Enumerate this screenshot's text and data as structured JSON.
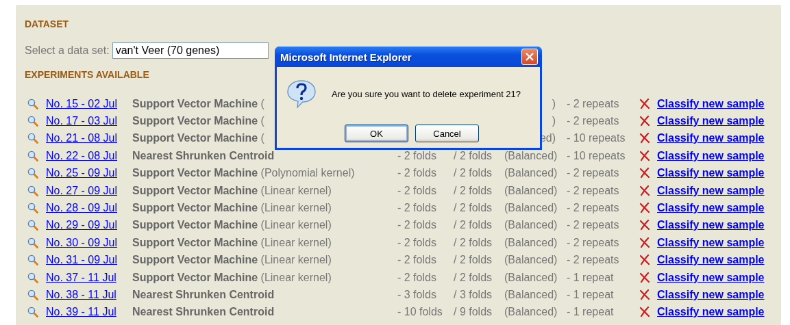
{
  "dataset": {
    "heading": "DATASET",
    "select_label": "Select a data set:",
    "select_value": "van't Veer (70 genes)"
  },
  "experiments": {
    "heading": "EXPERIMENTS AVAILABLE",
    "rows": [
      {
        "date": "No. 15 - 02 Jul",
        "method": "Support Vector Machine",
        "kernel": "(",
        "balance": ")",
        "repeats": "- 2 repeats",
        "action": "Classify new sample"
      },
      {
        "date": "No. 17 - 03 Jul",
        "method": "Support Vector Machine",
        "kernel": "(",
        "balance": ")",
        "repeats": "- 2 repeats",
        "action": "Classify new sample"
      },
      {
        "date": "No. 21 - 08 Jul",
        "method": "Support Vector Machine",
        "kernel": "(",
        "balance": "ed)",
        "repeats": "- 10 repeats",
        "action": "Classify new sample"
      },
      {
        "date": "No. 22 - 08 Jul",
        "method": "Nearest Shrunken Centroid",
        "folds": "- 2 folds",
        "inner_folds": "/ 2 folds",
        "balance": "(Balanced)",
        "repeats": "- 10 repeats",
        "action": "Classify new sample"
      },
      {
        "date": "No. 25 - 09 Jul",
        "method": "Support Vector Machine",
        "kernel": "(Polynomial kernel)",
        "folds": "- 2 folds",
        "inner_folds": "/ 2 folds",
        "balance": "(Balanced)",
        "repeats": "- 2 repeats",
        "action": "Classify new sample"
      },
      {
        "date": "No. 27 - 09 Jul",
        "method": "Support Vector Machine",
        "kernel": "(Linear kernel)",
        "folds": "- 2 folds",
        "inner_folds": "/ 2 folds",
        "balance": "(Balanced)",
        "repeats": "- 2 repeats",
        "action": "Classify new sample"
      },
      {
        "date": "No. 28 - 09 Jul",
        "method": "Support Vector Machine",
        "kernel": "(Linear kernel)",
        "folds": "- 2 folds",
        "inner_folds": "/ 2 folds",
        "balance": "(Balanced)",
        "repeats": "- 2 repeats",
        "action": "Classify new sample"
      },
      {
        "date": "No. 29 - 09 Jul",
        "method": "Support Vector Machine",
        "kernel": "(Linear kernel)",
        "folds": "- 2 folds",
        "inner_folds": "/ 2 folds",
        "balance": "(Balanced)",
        "repeats": "- 2 repeats",
        "action": "Classify new sample"
      },
      {
        "date": "No. 30 - 09 Jul",
        "method": "Support Vector Machine",
        "kernel": "(Linear kernel)",
        "folds": "- 2 folds",
        "inner_folds": "/ 2 folds",
        "balance": "(Balanced)",
        "repeats": "- 2 repeats",
        "action": "Classify new sample"
      },
      {
        "date": "No. 31 - 09 Jul",
        "method": "Support Vector Machine",
        "kernel": "(Linear kernel)",
        "folds": "- 2 folds",
        "inner_folds": "/ 2 folds",
        "balance": "(Balanced)",
        "repeats": "- 2 repeats",
        "action": "Classify new sample"
      },
      {
        "date": "No. 37 - 11 Jul",
        "method": "Support Vector Machine",
        "kernel": "(Linear kernel)",
        "folds": "- 2 folds",
        "inner_folds": "/ 2 folds",
        "balance": "(Balanced)",
        "repeats": "- 1 repeat",
        "action": "Classify new sample"
      },
      {
        "date": "No. 38 - 11 Jul",
        "method": "Nearest Shrunken Centroid",
        "folds": "- 3 folds",
        "inner_folds": "/ 3 folds",
        "balance": "(Balanced)",
        "repeats": "- 1 repeat",
        "action": "Classify new sample"
      },
      {
        "date": "No. 39 - 11 Jul",
        "method": "Nearest Shrunken Centroid",
        "folds": "- 10 folds",
        "inner_folds": "/ 9 folds",
        "balance": "(Balanced)",
        "repeats": "- 1 repeat",
        "action": "Classify new sample"
      }
    ]
  },
  "dialog": {
    "title": "Microsoft Internet Explorer",
    "message": "Are you sure you want to delete experiment 21?",
    "buttons": [
      "OK",
      "Cancel"
    ]
  }
}
